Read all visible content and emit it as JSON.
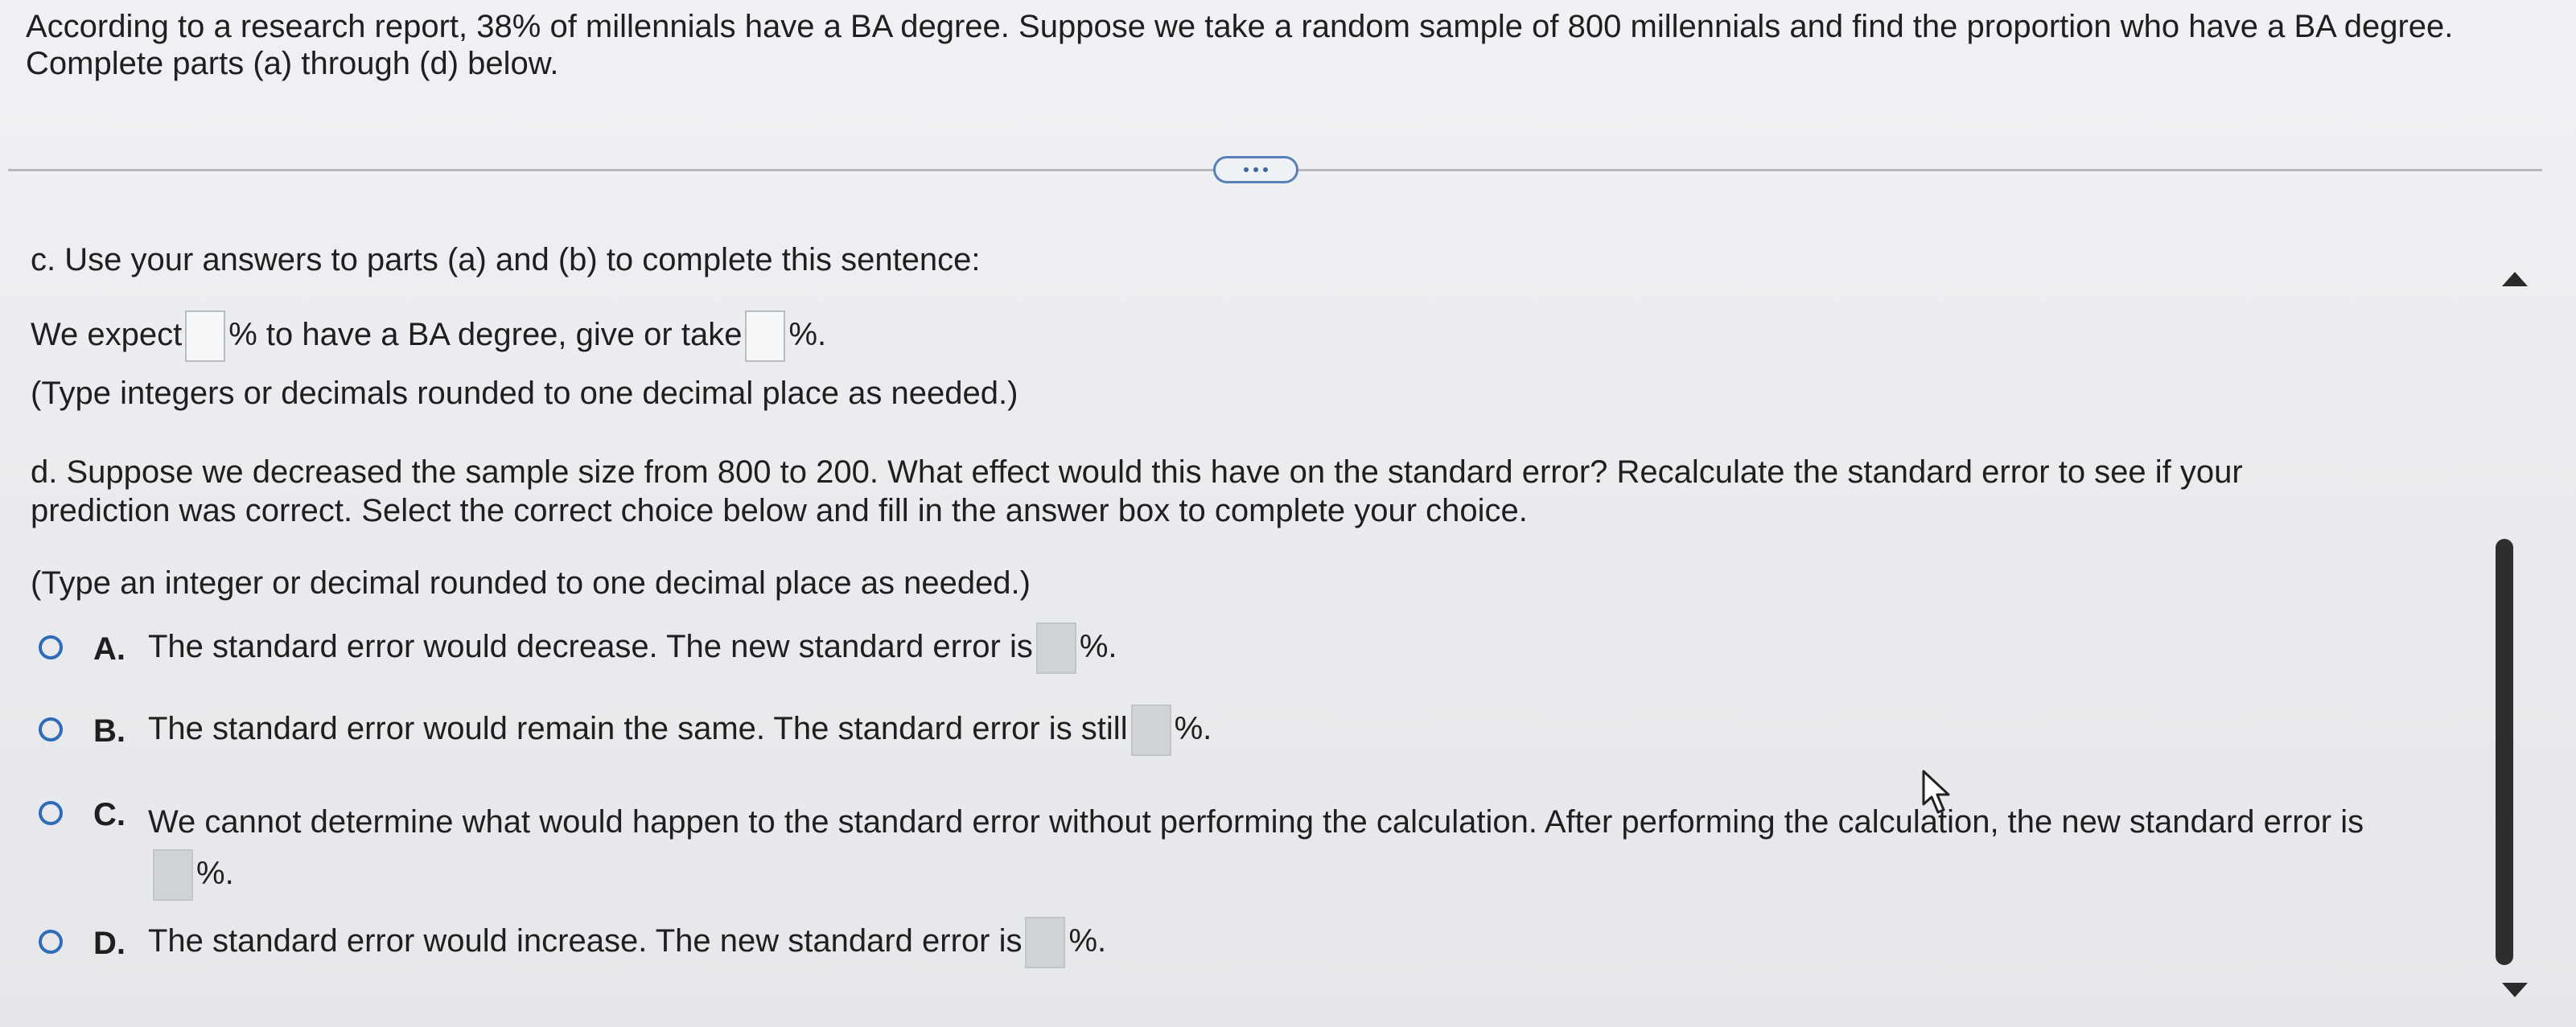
{
  "intro": {
    "text": "According to a research report, 38% of millennials have a BA degree. Suppose we take a random sample of 800 millennials and find the proportion who have a BA degree. Complete parts (a) through (d) below."
  },
  "part_c": {
    "prompt": "c. Use your answers to parts (a) and (b) to complete this sentence:",
    "sentence_start": "We expect",
    "sentence_mid": "% to have a BA degree, give or take",
    "sentence_end": "%.",
    "hint": "(Type integers or decimals rounded to one decimal place as needed.)"
  },
  "part_d": {
    "prompt_line1": "d. Suppose we decreased the sample size from 800 to 200. What effect would this have on the standard error? Recalculate the standard error to see if your",
    "prompt_line2": "prediction was correct. Select the correct choice below and fill in the answer box to complete your choice.",
    "hint": "(Type an integer or decimal rounded to one decimal place as needed.)",
    "options": [
      {
        "letter": "A.",
        "text": "The standard error would decrease. The new standard error is",
        "suffix": "%."
      },
      {
        "letter": "B.",
        "text": "The standard error would remain the same. The standard error is still",
        "suffix": "%."
      },
      {
        "letter": "C.",
        "text": "We cannot determine what would happen to the standard error without performing the calculation. After performing the calculation, the new standard error is",
        "suffix": "%."
      },
      {
        "letter": "D.",
        "text": "The standard error would increase. The new standard error is",
        "suffix": "%."
      }
    ]
  },
  "icons": {
    "more": "more-options-icon",
    "scroll_up": "scroll-up-icon",
    "scroll_down": "scroll-down-icon",
    "cursor": "mouse-cursor-icon"
  },
  "colors": {
    "accent": "#2f6bb7",
    "text": "#1f1f1f",
    "background": "#ebecef"
  }
}
